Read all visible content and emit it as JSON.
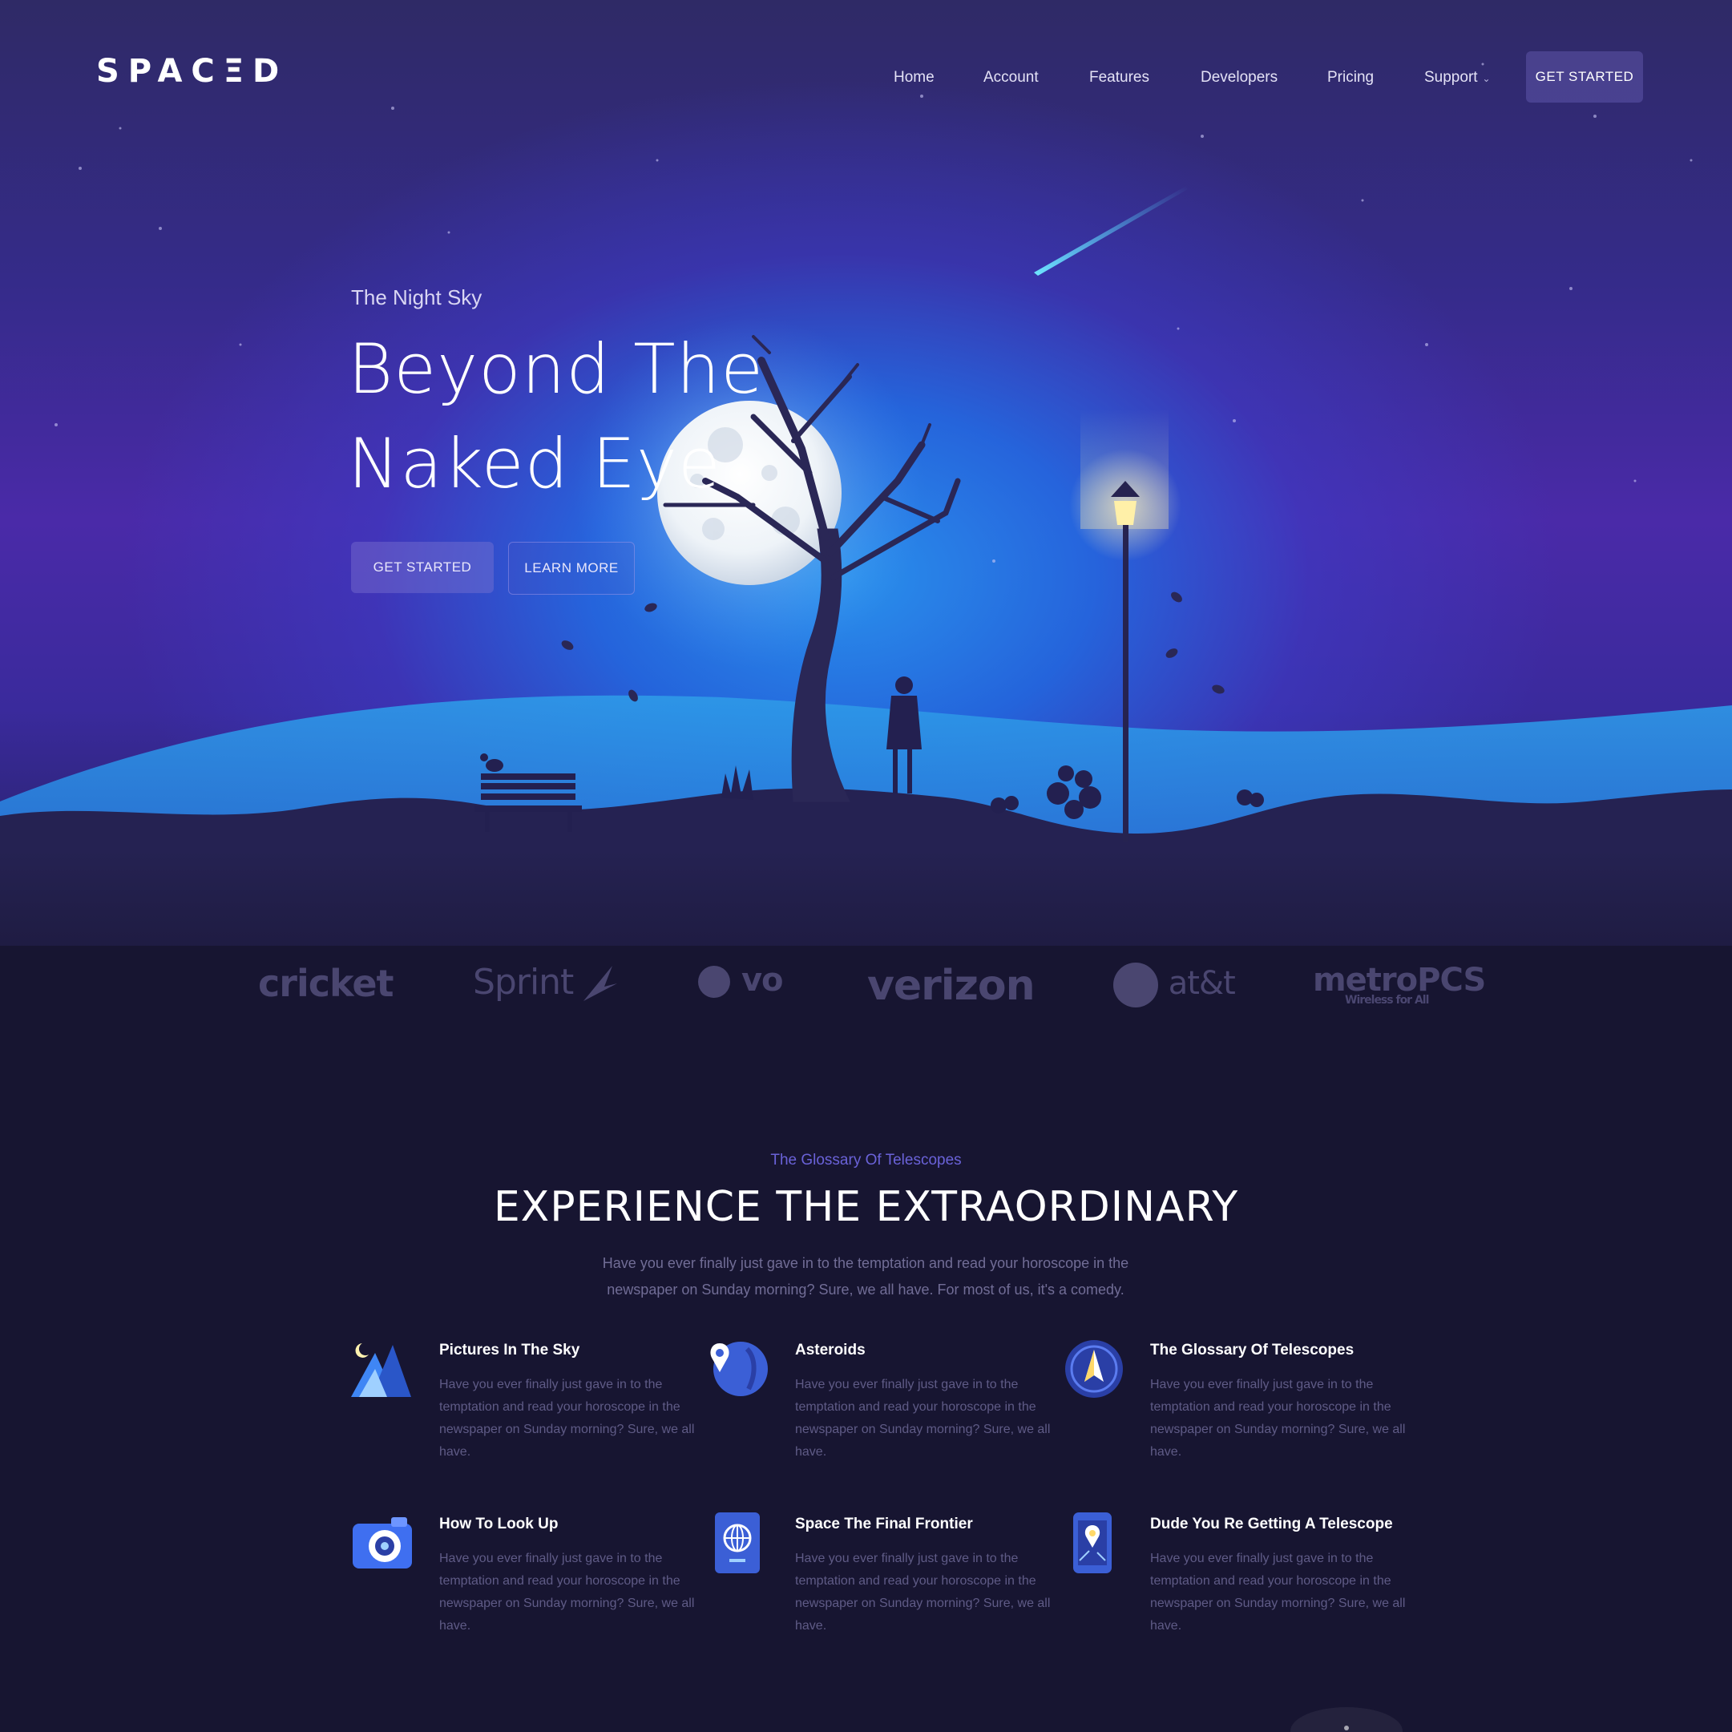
{
  "brand": {
    "logo": "SPACΞD"
  },
  "nav": {
    "items": [
      {
        "label": "Home"
      },
      {
        "label": "Account"
      },
      {
        "label": "Features"
      },
      {
        "label": "Developers"
      },
      {
        "label": "Pricing"
      },
      {
        "label": "Support"
      }
    ],
    "support_caret": "⌄",
    "cta": "GET STARTED"
  },
  "hero": {
    "eyebrow": "The Night Sky",
    "title_line1": "Beyond The",
    "title_line2": "Naked Eye",
    "primary_cta": "GET STARTED",
    "secondary_cta": "LEARN MORE"
  },
  "partners": [
    "cricket",
    "Sprint",
    "vo",
    "verizon",
    "at&t",
    "metroPCS"
  ],
  "partners_tagline": "Wireless for All",
  "features_section": {
    "eyebrow": "The Glossary Of Telescopes",
    "title": "EXPERIENCE THE EXTRAORDINARY",
    "description": "Have you ever finally just gave in to the temptation and read your horoscope in the newspaper on Sunday morning? Sure, we all have. For most of us, it's a comedy.",
    "items": [
      {
        "title": "Pictures In The Sky",
        "text": "Have you ever finally just gave in to the temptation and read your horoscope in the newspaper on Sunday morning? Sure, we all have.",
        "icon": "mountain-moon-icon"
      },
      {
        "title": "Asteroids",
        "text": "Have you ever finally just gave in to the temptation and read your horoscope in the newspaper on Sunday morning? Sure, we all have.",
        "icon": "location-globe-icon"
      },
      {
        "title": "The Glossary Of Telescopes",
        "text": "Have you ever finally just gave in to the temptation and read your horoscope in the newspaper on Sunday morning? Sure, we all have.",
        "icon": "compass-icon"
      },
      {
        "title": "How To Look Up",
        "text": "Have you ever finally just gave in to the temptation and read your horoscope in the newspaper on Sunday morning? Sure, we all have.",
        "icon": "camera-icon"
      },
      {
        "title": "Space The Final Frontier",
        "text": "Have you ever finally just gave in to the temptation and read your horoscope in the newspaper on Sunday morning? Sure, we all have.",
        "icon": "passport-icon"
      },
      {
        "title": "Dude You Re Getting A Telescope",
        "text": "Have you ever finally just gave in to the temptation and read your horoscope in the newspaper on Sunday morning? Sure, we all have.",
        "icon": "phone-map-icon"
      }
    ]
  },
  "colors": {
    "background": "#171531",
    "accent": "#6a62d8",
    "sky_glow": "#2d8ef0"
  }
}
